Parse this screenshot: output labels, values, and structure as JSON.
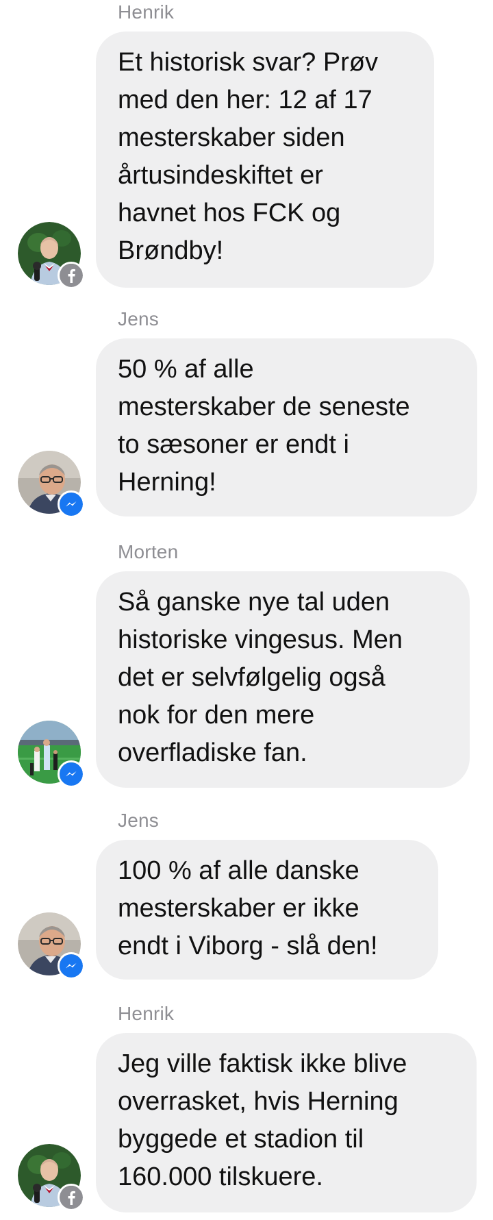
{
  "colors": {
    "bubble_bg": "#efeff0",
    "sender_text": "#8e8e93",
    "message_text": "#111111",
    "facebook_badge": "#8e8e93",
    "messenger_badge": "#1877f2"
  },
  "messages": [
    {
      "sender": "Henrik",
      "avatar_icon": "avatar-henrik",
      "badge_icon": "facebook-badge-icon",
      "lines": [
        "Et historisk svar? Prøv",
        "med den her: 12 af 17",
        "mesterskaber siden",
        "årtusindeskiftet er",
        "havnet hos FCK og",
        "Brøndby!"
      ]
    },
    {
      "sender": "Jens",
      "avatar_icon": "avatar-jens",
      "badge_icon": "messenger-badge-icon",
      "lines": [
        "50 % af alle",
        "mesterskaber de seneste",
        "to sæsoner er endt i",
        "Herning!"
      ]
    },
    {
      "sender": "Morten",
      "avatar_icon": "avatar-morten",
      "badge_icon": "messenger-badge-icon",
      "lines": [
        "Så ganske nye tal uden",
        "historiske vingesus. Men",
        "det er selvfølgelig også",
        "nok for den mere",
        "overfladiske fan."
      ]
    },
    {
      "sender": "Jens",
      "avatar_icon": "avatar-jens",
      "badge_icon": "messenger-badge-icon",
      "lines": [
        "100 % af alle danske",
        "mesterskaber er ikke",
        "endt i Viborg - slå den!"
      ]
    },
    {
      "sender": "Henrik",
      "avatar_icon": "avatar-henrik",
      "badge_icon": "facebook-badge-icon",
      "lines": [
        "Jeg ville faktisk ikke blive",
        "overrasket, hvis Herning",
        "byggede et stadion til",
        "160.000 tilskuere."
      ]
    }
  ]
}
